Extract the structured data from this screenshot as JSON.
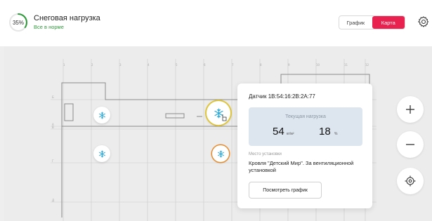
{
  "header": {
    "gauge": {
      "text": "35%",
      "value": 0.35,
      "color": "#2e9a3a"
    },
    "title": "Снеговая нагрузка",
    "status": "Все в норме",
    "status_color": "#2e9a3a"
  },
  "view_toggle": {
    "options": [
      "График",
      "Карта"
    ],
    "selected": "Карта",
    "accent": "#e8214e"
  },
  "settings_icon": "gear-icon",
  "plan": {
    "column_labels": [
      "1",
      "2",
      "3",
      "4",
      "5",
      "6",
      "7",
      "8",
      "9",
      "10",
      "11",
      "12"
    ],
    "row_labels": [
      "Б",
      "А",
      "В",
      "Г",
      "Д"
    ]
  },
  "sensors": [
    {
      "icon": "snowflake-icon"
    },
    {
      "icon": "snowflake-icon",
      "selected": true
    },
    {
      "icon": "snowflake-icon"
    },
    {
      "icon": "snowflake-icon"
    }
  ],
  "popup": {
    "title": "Датчик 1B:54:16:2B:2A:77",
    "current_load_label": "Текущая нагрузка",
    "load_value": "54",
    "load_unit": "кг/м²",
    "load_percent": "18",
    "percent_unit": "%",
    "location_label": "Место установки",
    "location": "Кровля \"Детский Мир\". За вентиляционной установкой",
    "graph_button": "Посмотреть график"
  },
  "controls": {
    "zoom_in_icon": "plus-icon",
    "zoom_out_icon": "minus-icon",
    "locate_icon": "locate-icon"
  }
}
